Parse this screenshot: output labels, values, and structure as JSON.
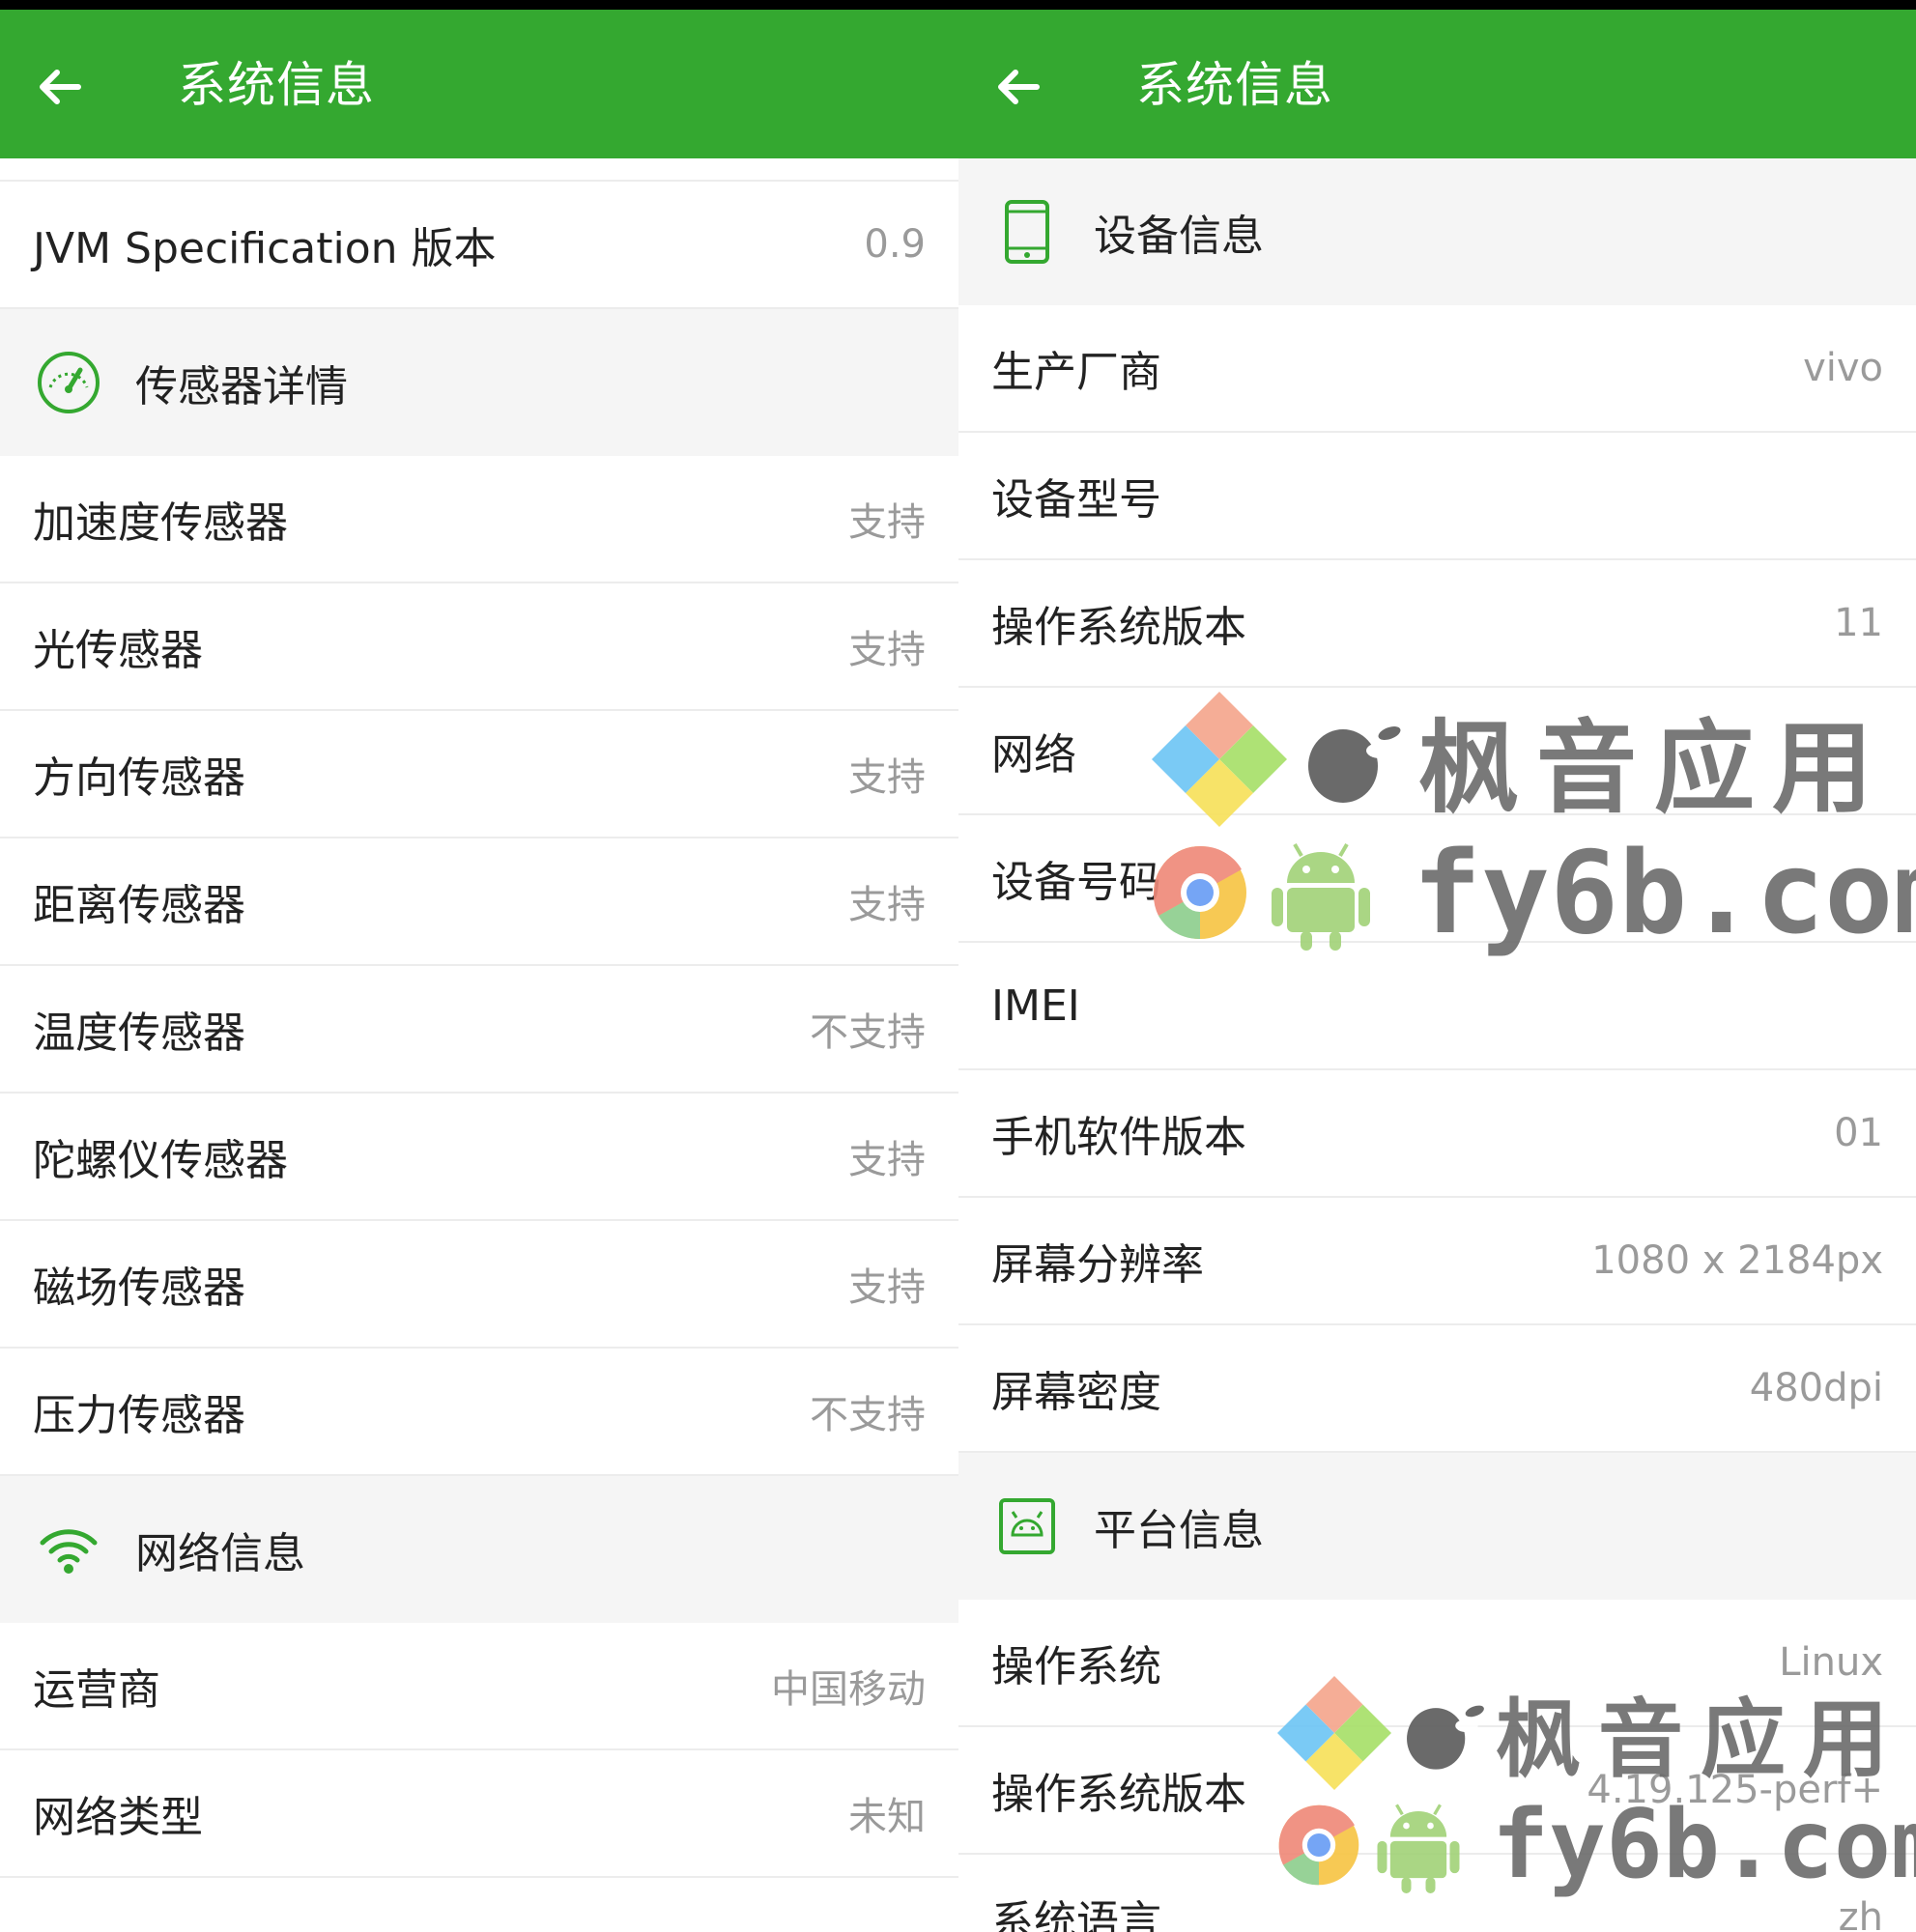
{
  "left": {
    "appbar": {
      "title": "系统信息"
    },
    "top_row": {
      "label": "JVM Specification 版本",
      "value": "0.9"
    },
    "sensor_section": {
      "title": "传感器详情"
    },
    "sensors": [
      {
        "label": "加速度传感器",
        "value": "支持"
      },
      {
        "label": "光传感器",
        "value": "支持"
      },
      {
        "label": "方向传感器",
        "value": "支持"
      },
      {
        "label": "距离传感器",
        "value": "支持"
      },
      {
        "label": "温度传感器",
        "value": "不支持"
      },
      {
        "label": "陀螺仪传感器",
        "value": "支持"
      },
      {
        "label": "磁场传感器",
        "value": "支持"
      },
      {
        "label": "压力传感器",
        "value": "不支持"
      }
    ],
    "network_section": {
      "title": "网络信息"
    },
    "network": [
      {
        "label": "运营商",
        "value": "中国移动"
      },
      {
        "label": "网络类型",
        "value": "未知"
      }
    ]
  },
  "right": {
    "appbar": {
      "title": "系统信息"
    },
    "device_section": {
      "title": "设备信息"
    },
    "device": [
      {
        "label": "生产厂商",
        "value": "vivo"
      },
      {
        "label": "设备型号",
        "value": ""
      },
      {
        "label": "操作系统版本",
        "value": "11"
      },
      {
        "label": "网络",
        "value": ""
      },
      {
        "label": "设备号码",
        "value": ""
      },
      {
        "label": "IMEI",
        "value": ""
      },
      {
        "label": "手机软件版本",
        "value": "01"
      },
      {
        "label": "屏幕分辨率",
        "value": "1080 x 2184px"
      },
      {
        "label": "屏幕密度",
        "value": "480dpi"
      }
    ],
    "platform_section": {
      "title": "平台信息"
    },
    "platform": [
      {
        "label": "操作系统",
        "value": "Linux"
      },
      {
        "label": "操作系统版本",
        "value": "4.19.125-perf+"
      },
      {
        "label": "系统语言",
        "value": "zh"
      }
    ]
  },
  "watermark": {
    "cn": "枫音应用",
    "en": "fy6b.com"
  },
  "colors": {
    "accent": "#34a830",
    "section_bg": "#f5f5f5",
    "value_text": "#9a9a9a"
  },
  "icons": [
    "back-arrow-icon",
    "speedometer-icon",
    "wifi-icon",
    "phone-icon",
    "android-icon"
  ]
}
